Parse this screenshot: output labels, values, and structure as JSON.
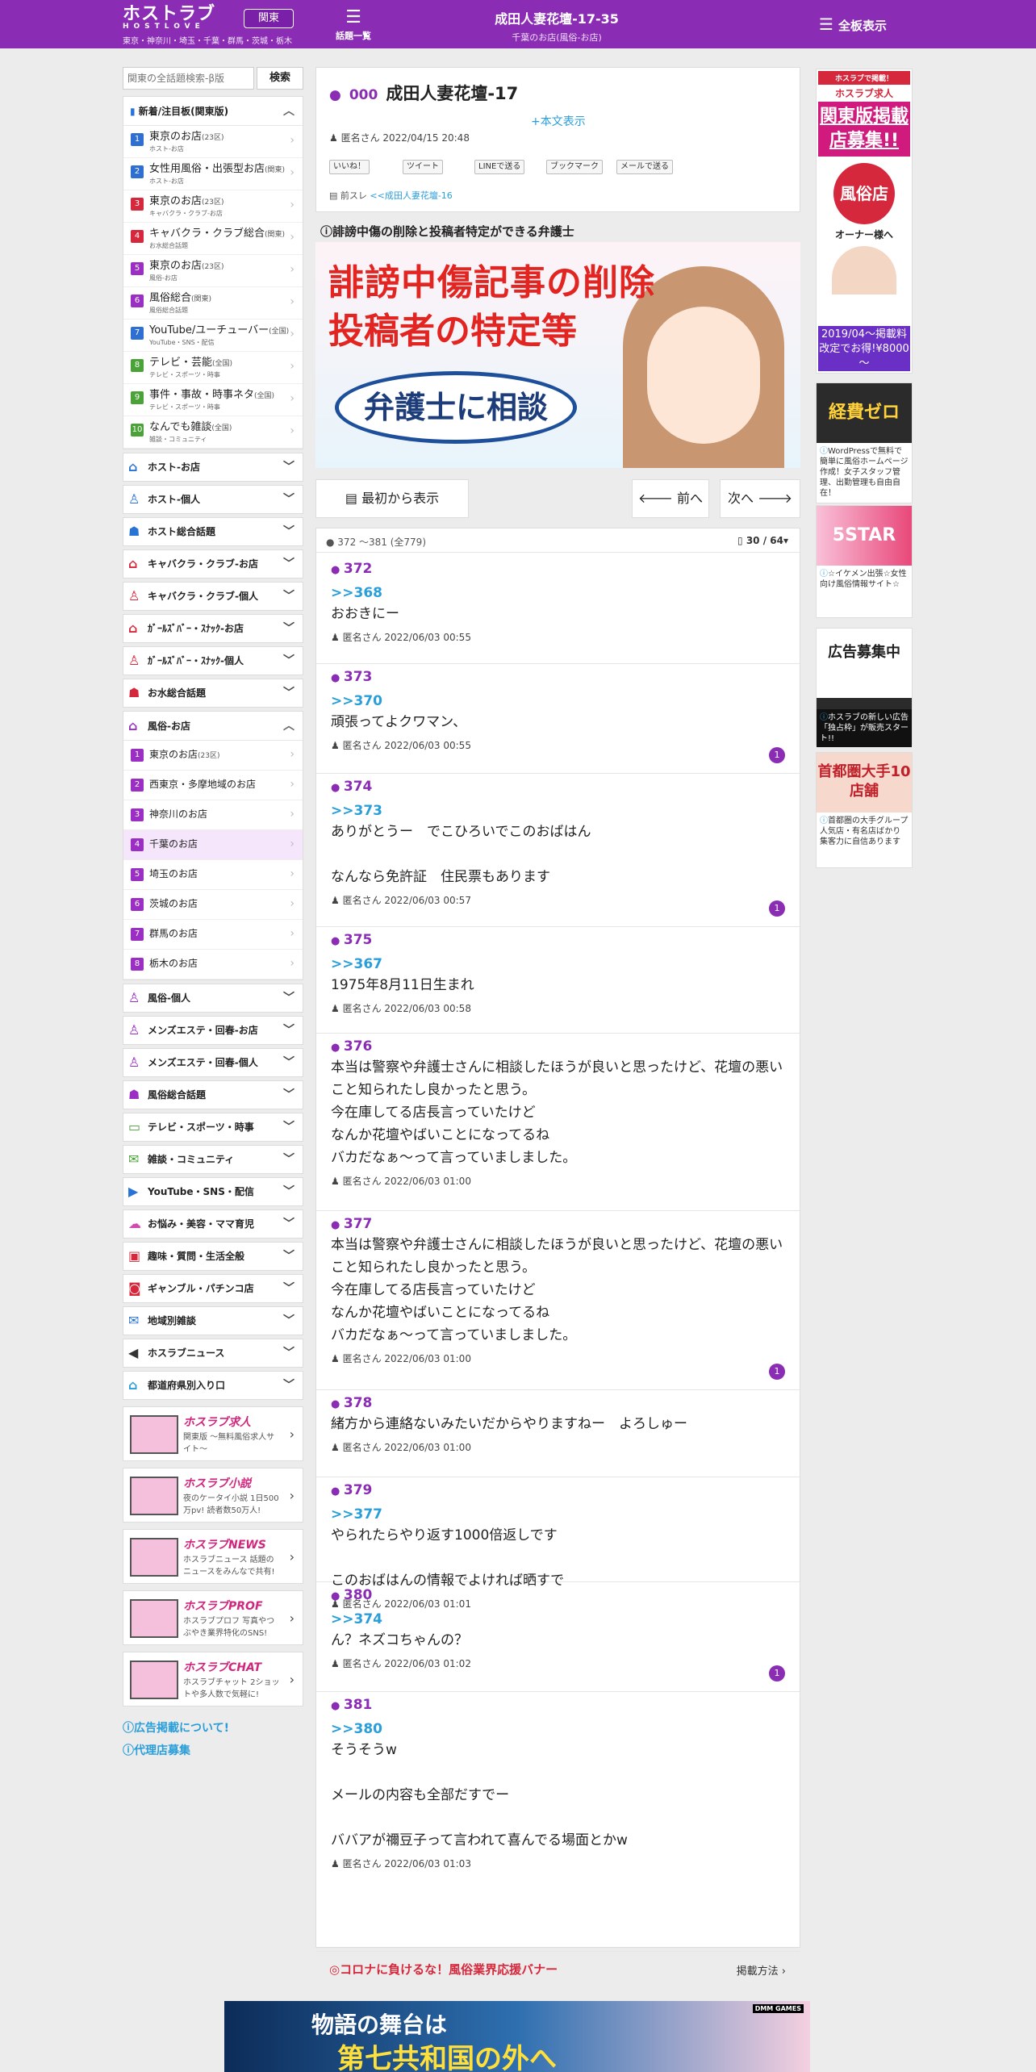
{
  "header": {
    "logo": "ホストラブ",
    "logo_sub": "HOSTLOVE",
    "region": "関東",
    "areas": "東京・神奈川・埼玉・千葉・群馬・茨城・栃木",
    "topics_label": "話題一覧",
    "title": "成田人妻花壇-17-35",
    "subtitle": "千葉のお店(風俗-お店)",
    "all_boards": "全板表示"
  },
  "search": {
    "placeholder": "関東の全話題検索-β版",
    "button": "検索"
  },
  "left": {
    "new_header": "新着/注目板(関東版)",
    "new_items": [
      {
        "n": "1",
        "name": "東京のお店",
        "tag": "(23区)",
        "sub": "ホスト-お店",
        "color": "#2f6fd1"
      },
      {
        "n": "2",
        "name": "女性用風俗・出張型お店",
        "tag": "(関東)",
        "sub": "ホスト-お店",
        "color": "#2f6fd1"
      },
      {
        "n": "3",
        "name": "東京のお店",
        "tag": "(23区)",
        "sub": "キャバクラ・クラブ-お店",
        "color": "#d6283c"
      },
      {
        "n": "4",
        "name": "キャバクラ・クラブ総合",
        "tag": "(関東)",
        "sub": "お水総合話題",
        "color": "#d6283c"
      },
      {
        "n": "5",
        "name": "東京のお店",
        "tag": "(23区)",
        "sub": "風俗-お店",
        "color": "#9b2fc4"
      },
      {
        "n": "6",
        "name": "風俗総合",
        "tag": "(関東)",
        "sub": "風俗総合話題",
        "color": "#9b2fc4"
      },
      {
        "n": "7",
        "name": "YouTube/ユーチューバー",
        "tag": "(全国)",
        "sub": "YouTube・SNS・配信",
        "color": "#2f6fd1"
      },
      {
        "n": "8",
        "name": "テレビ・芸能",
        "tag": "(全国)",
        "sub": "テレビ・スポーツ・時事",
        "color": "#4aa238"
      },
      {
        "n": "9",
        "name": "事件・事故・時事ネタ",
        "tag": "(全国)",
        "sub": "テレビ・スポーツ・時事",
        "color": "#4aa238"
      },
      {
        "n": "10",
        "name": "なんでも雑談",
        "tag": "(全国)",
        "sub": "雑談・コミュニティ",
        "color": "#4aa238"
      }
    ],
    "cats_a": [
      {
        "name": "ホスト-お店",
        "icon": "⌂",
        "color": "#2a73d6"
      },
      {
        "name": "ホスト-個人",
        "icon": "♙",
        "color": "#2a73d6"
      },
      {
        "name": "ホスト総合話題",
        "icon": "☗",
        "color": "#2a73d6"
      },
      {
        "name": "キャバクラ・クラブ-お店",
        "icon": "⌂",
        "color": "#d6283c"
      },
      {
        "name": "キャバクラ・クラブ-個人",
        "icon": "♙",
        "color": "#d6283c"
      },
      {
        "name": "ｶﾞｰﾙｽﾞﾊﾞｰ・ｽﾅｯｸ-お店",
        "icon": "⌂",
        "color": "#d6283c"
      },
      {
        "name": "ｶﾞｰﾙｽﾞﾊﾞｰ・ｽﾅｯｸ-個人",
        "icon": "♙",
        "color": "#d6283c"
      },
      {
        "name": "お水総合話題",
        "icon": "☗",
        "color": "#d6283c"
      }
    ],
    "fuzoku_header": "風俗-お店",
    "fuzoku_items": [
      "東京のお店",
      "西東京・多摩地域のお店",
      "神奈川のお店",
      "千葉のお店",
      "埼玉のお店",
      "茨城のお店",
      "群馬のお店",
      "栃木のお店"
    ],
    "fuzoku_tag": "(23区)",
    "cats_b": [
      {
        "name": "風俗-個人",
        "icon": "♙",
        "color": "#9b2fc4"
      },
      {
        "name": "メンズエステ・回春-お店",
        "icon": "♙",
        "color": "#9b2fc4"
      },
      {
        "name": "メンズエステ・回春-個人",
        "icon": "♙",
        "color": "#9b2fc4"
      },
      {
        "name": "風俗総合話題",
        "icon": "☗",
        "color": "#9b2fc4"
      },
      {
        "name": "テレビ・スポーツ・時事",
        "icon": "▭",
        "color": "#4aa238"
      },
      {
        "name": "雑談・コミュニティ",
        "icon": "✉",
        "color": "#4aa238"
      },
      {
        "name": "YouTube・SNS・配信",
        "icon": "▶",
        "color": "#2a73d6"
      },
      {
        "name": "お悩み・美容・ママ育児",
        "icon": "☁",
        "color": "#d04ab0"
      },
      {
        "name": "趣味・質問・生活全般",
        "icon": "▣",
        "color": "#d6283c"
      },
      {
        "name": "ギャンブル・パチンコ店",
        "icon": "◙",
        "color": "#d6283c"
      },
      {
        "name": "地域別雑談",
        "icon": "✉",
        "color": "#2a73d6"
      },
      {
        "name": "ホスラブニュース",
        "icon": "◀",
        "color": "#333"
      },
      {
        "name": "都道府県別入り口",
        "icon": "⌂",
        "color": "#2a9ed9"
      }
    ],
    "banners": [
      {
        "title": "ホスラブ求人",
        "sub": "関東版 〜無料風俗求人サイト〜"
      },
      {
        "title": "ホスラブ小説",
        "sub": "夜のケータイ小説 1日500万pv! 読者数50万人!"
      },
      {
        "title": "ホスラブNEWS",
        "sub": "ホスラブニュース 話題のニュースをみんなで共有!"
      },
      {
        "title": "ホスラブPROF",
        "sub": "ホスラブプロフ 写真やつぶやき業界特化のSNS!"
      },
      {
        "title": "ホスラブCHAT",
        "sub": "ホスラブチャット 2ショットや多人数で気軽に!"
      }
    ],
    "links": [
      "広告掲載について!",
      "代理店募集"
    ]
  },
  "thread": {
    "no": "000",
    "title": "成田人妻花壇-17",
    "more": "+本文表示",
    "author": "匿名さん 2022/04/15 20:48",
    "share": [
      "いいね！",
      "ツイート",
      "LINEで送る",
      "ブックマーク",
      "メールで送る"
    ],
    "prev_label": "前スレ",
    "prev_link": "<<成田人妻花壇-16"
  },
  "ad": {
    "caption": "誹謗中傷の削除と投稿者特定ができる弁護士",
    "line1": "誹謗中傷記事の削除",
    "line2": "投稿者の特定等",
    "bubble": "弁護士に相談"
  },
  "nav": {
    "first": "最初から表示",
    "prev": "前へ",
    "next": "次へ"
  },
  "range": {
    "label": "372 ～381 (全779)",
    "page": "30 / 64"
  },
  "posts": [
    {
      "no": "372",
      "reply": ">>368",
      "body": "おおきにー",
      "meta": "匿名さん 2022/06/03 00:55",
      "badge": ""
    },
    {
      "no": "373",
      "reply": ">>370",
      "body": "頑張ってよクワマン、",
      "meta": "匿名さん 2022/06/03 00:55",
      "badge": "1"
    },
    {
      "no": "374",
      "reply": ">>373",
      "body": "ありがとうー　でこひろいでこのおばはん\n\nなんなら免許証　住民票もあります",
      "meta": "匿名さん 2022/06/03 00:57",
      "badge": "1"
    },
    {
      "no": "375",
      "reply": ">>367",
      "body": "1975年8月11日生まれ",
      "meta": "匿名さん 2022/06/03 00:58",
      "badge": ""
    },
    {
      "no": "376",
      "reply": "",
      "body": "本当は警察や弁護士さんに相談したほうが良いと思ったけど、花壇の悪いこと知られたし良かったと思う。\n今在庫してる店長言っていたけど\nなんか花壇やばいことになってるね\nバカだなぁ～って言っていましました。",
      "meta": "匿名さん 2022/06/03 01:00",
      "badge": ""
    },
    {
      "no": "377",
      "reply": "",
      "body": "本当は警察や弁護士さんに相談したほうが良いと思ったけど、花壇の悪いこと知られたし良かったと思う。\n今在庫してる店長言っていたけど\nなんか花壇やばいことになってるね\nバカだなぁ～って言っていましました。",
      "meta": "匿名さん 2022/06/03 01:00",
      "badge": "1"
    },
    {
      "no": "378",
      "reply": "",
      "body": "緒方から連絡ないみたいだからやりますねー　よろしゅー",
      "meta": "匿名さん 2022/06/03 01:00",
      "badge": ""
    },
    {
      "no": "379",
      "reply": ">>377",
      "body": "やられたらやり返す1000倍返しです\n\nこのおばはんの情報でよければ晒すで",
      "meta": "匿名さん 2022/06/03 01:01",
      "badge": ""
    },
    {
      "no": "380",
      "reply": ">>374",
      "body": "ん？ネズコちゃんの？",
      "meta": "匿名さん 2022/06/03 01:02",
      "badge": "1"
    },
    {
      "no": "381",
      "reply": ">>380",
      "body": "そうそうw\n\nメールの内容も全部だすでー\n\nババアが禰豆子って言われて喜んでる場面とかw",
      "meta": "匿名さん 2022/06/03 01:03",
      "badge": ""
    }
  ],
  "corona": {
    "label": "◎コロナに負けるな！風俗業界応援バナー",
    "link": "掲載方法"
  },
  "right": {
    "ad1": {
      "top": "ホスラブで掲載！",
      "brand": "ホスラブ求人",
      "big": "関東版掲載店募集!!",
      "tag": "風俗店",
      "sub": "オーナー様へ",
      "price": "2019/04～掲載料改定でお得!¥8000～"
    },
    "ad2": {
      "text": "経費ゼロ",
      "cap": "WordPressで無料で簡単に風俗ホームページ作成！女子スタッフ管理、出勤管理も自由自在！"
    },
    "ad3": {
      "text": "5STAR",
      "cap": "☆イケメン出張☆女性向け風俗情報サイト☆"
    },
    "ad4": {
      "text": "広告募集中",
      "cap": "ホスラブの新しい広告「独占枠」が販売スタート!!"
    },
    "ad5": {
      "text": "首都圏大手10店舗",
      "cap": "首都圏の大手グループ人気店・有名店ばかり 集客力に自信あります"
    }
  },
  "bottom_ad": {
    "line1": "物語の舞台は",
    "line2": "第七共和国の外へ",
    "tag": "DMM GAMES"
  }
}
